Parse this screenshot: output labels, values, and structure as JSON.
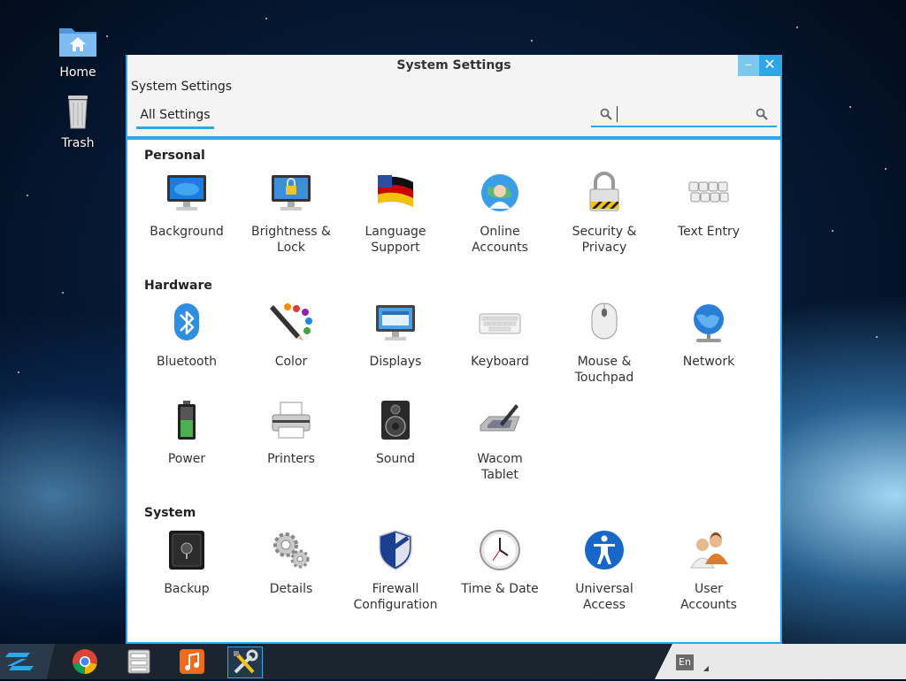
{
  "desktop": {
    "icons": [
      {
        "label": "Home"
      },
      {
        "label": "Trash"
      }
    ]
  },
  "window": {
    "title": "System Settings",
    "subtitle": "System Settings",
    "tab_all": "All Settings",
    "search_placeholder": "",
    "minimize": "–",
    "close": "✕"
  },
  "sections": {
    "personal": {
      "title": "Personal",
      "items": [
        {
          "label1": "Background",
          "label2": "",
          "icon": "monitor-icon"
        },
        {
          "label1": "Brightness &",
          "label2": "Lock",
          "icon": "brightness-lock-icon"
        },
        {
          "label1": "Language",
          "label2": "Support",
          "icon": "flag-icon"
        },
        {
          "label1": "Online",
          "label2": "Accounts",
          "icon": "globe-user-icon"
        },
        {
          "label1": "Security &",
          "label2": "Privacy",
          "icon": "padlock-icon"
        },
        {
          "label1": "Text Entry",
          "label2": "",
          "icon": "keys-icon"
        }
      ]
    },
    "hardware": {
      "title": "Hardware",
      "items": [
        {
          "label1": "Bluetooth",
          "label2": "",
          "icon": "bluetooth-icon"
        },
        {
          "label1": "Color",
          "label2": "",
          "icon": "color-pencil-icon"
        },
        {
          "label1": "Displays",
          "label2": "",
          "icon": "display-icon"
        },
        {
          "label1": "Keyboard",
          "label2": "",
          "icon": "keyboard-icon"
        },
        {
          "label1": "Mouse &",
          "label2": "Touchpad",
          "icon": "mouse-icon"
        },
        {
          "label1": "Network",
          "label2": "",
          "icon": "network-globe-icon"
        },
        {
          "label1": "Power",
          "label2": "",
          "icon": "battery-icon"
        },
        {
          "label1": "Printers",
          "label2": "",
          "icon": "printer-icon"
        },
        {
          "label1": "Sound",
          "label2": "",
          "icon": "speaker-icon"
        },
        {
          "label1": "Wacom",
          "label2": "Tablet",
          "icon": "tablet-icon"
        }
      ]
    },
    "system": {
      "title": "System",
      "items": [
        {
          "label1": "Backup",
          "label2": "",
          "icon": "safe-icon"
        },
        {
          "label1": "Details",
          "label2": "",
          "icon": "gears-icon"
        },
        {
          "label1": "Firewall",
          "label2": "Configuration",
          "icon": "shield-icon"
        },
        {
          "label1": "Time & Date",
          "label2": "",
          "icon": "clock-icon"
        },
        {
          "label1": "Universal",
          "label2": "Access",
          "icon": "accessibility-icon"
        },
        {
          "label1": "User",
          "label2": "Accounts",
          "icon": "users-icon"
        }
      ]
    }
  },
  "taskbar": {
    "lang": "En"
  },
  "colors": {
    "accent": "#2ea6e8",
    "window_bg": "#f4f4f4",
    "taskbar": "#1b2530"
  }
}
